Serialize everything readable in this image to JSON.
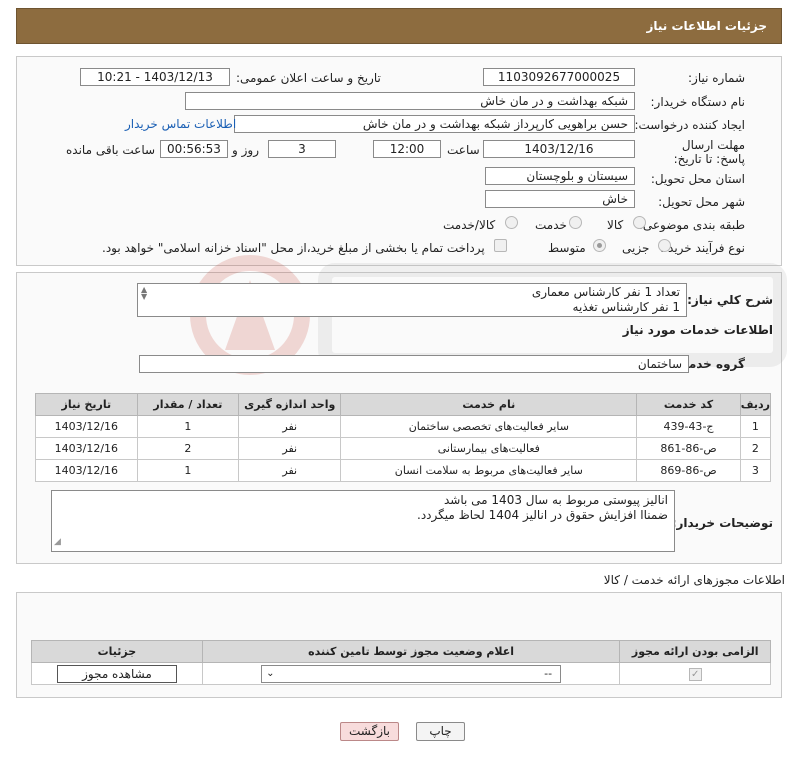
{
  "header": {
    "title": "جزئیات اطلاعات نیاز"
  },
  "form": {
    "need_number_label": "شماره نیاز:",
    "need_number": "1103092677000025",
    "announce_label": "تاریخ و ساعت اعلان عمومی:",
    "announce_value": "1403/12/13 - 10:21",
    "buyer_org_label": "نام دستگاه خریدار:",
    "buyer_org": "شبکه بهداشت و در مان خاش",
    "creator_label": "ایجاد کننده درخواست:",
    "creator": "حسن براهویی کارپرداز شبکه بهداشت و در مان خاش",
    "contact_link": "اطلاعات تماس خریدار",
    "deadline_label": "مهلت ارسال پاسخ: تا تاریخ:",
    "deadline_date": "1403/12/16",
    "time_label": "ساعت",
    "deadline_time": "12:00",
    "days": "3",
    "days_label": "روز و",
    "remaining_time": "00:56:53",
    "remaining_label": "ساعت باقی مانده",
    "province_label": "استان محل تحویل:",
    "province": "سیستان و بلوچستان",
    "city_label": "شهر محل تحویل:",
    "city": "خاش",
    "category_label": "طبقه بندی موضوعی:",
    "category_options": [
      "کالا",
      "خدمت",
      "کالا/خدمت"
    ],
    "process_label": "نوع فرآیند خرید :",
    "process_options": [
      "جزیی",
      "متوسط"
    ],
    "treasury_note": "پرداخت تمام یا بخشی از مبلغ خرید،از محل \"اسناد خزانه اسلامی\" خواهد بود."
  },
  "summary": {
    "label": "شرح کلي نياز:",
    "line1": "تعداد 1 نفر کارشناس معماری",
    "line2": "1 نفر کارشناس تغذیه"
  },
  "services": {
    "title": "اطلاعات خدمات مورد نیاز",
    "group_label": "گروه خدمت:",
    "group_value": "ساختمان",
    "columns": [
      "ردیف",
      "کد خدمت",
      "نام خدمت",
      "واحد اندازه گیری",
      "تعداد / مقدار",
      "تاریخ نیاز"
    ],
    "rows": [
      {
        "idx": "1",
        "code": "ج-43-439",
        "name": "سایر فعالیت‌های تخصصی ساختمان",
        "unit": "نفر",
        "qty": "1",
        "date": "1403/12/16"
      },
      {
        "idx": "2",
        "code": "ص-86-861",
        "name": "فعالیت‌های بیمارستانی",
        "unit": "نفر",
        "qty": "2",
        "date": "1403/12/16"
      },
      {
        "idx": "3",
        "code": "ص-86-869",
        "name": "سایر فعالیت‌های مربوط به سلامت انسان",
        "unit": "نفر",
        "qty": "1",
        "date": "1403/12/16"
      }
    ]
  },
  "buyer_notes": {
    "label": "توضیحات خریدار:",
    "line1": "انالیز پیوستی مربوط به سال 1403 می باشد",
    "line2": "ضمناا افزایش حقوق در انالیز 1404 لحاظ میگردد."
  },
  "permits": {
    "title": "اطلاعات مجوزهای ارائه خدمت / کالا",
    "columns": [
      "الزامی بودن ارائه مجوز",
      "اعلام وضعیت مجوز توسط تامین کننده",
      "جزئیات"
    ],
    "select_value": "--",
    "view_button": "مشاهده مجوز"
  },
  "buttons": {
    "print": "چاپ",
    "back": "بازگشت"
  },
  "colors": {
    "header_bg": "#8d6c3f",
    "link": "#1a5fb4",
    "back_btn_bg": "#f8dcdc"
  }
}
